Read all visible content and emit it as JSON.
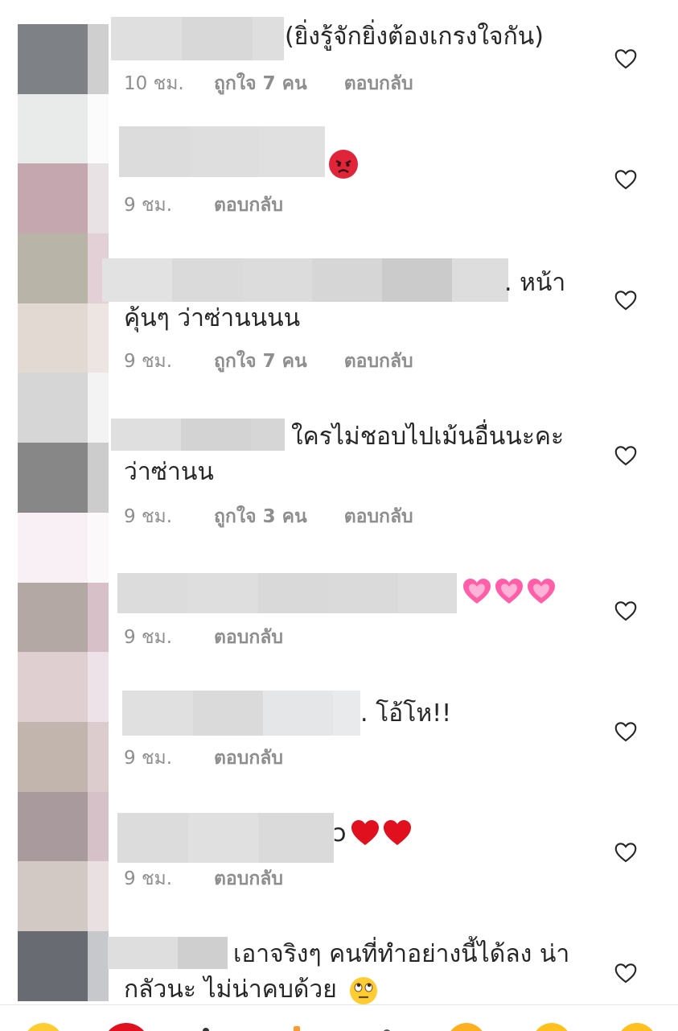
{
  "comments": [
    {
      "text": "(ยิ่งรู้จักยิ่งต้องเกรงใจกัน)",
      "time": "10 ชม.",
      "likes": "ถูกใจ 7 คน",
      "reply": "ตอบกลับ"
    },
    {
      "text": "",
      "time": "9 ชม.",
      "likes": "",
      "reply": "ตอบกลับ",
      "emoji": "pouting-face"
    },
    {
      "text": ". หน้า",
      "text2": "คุ้นๆ ว่าซ่านนนน",
      "time": "9 ชม.",
      "likes": "ถูกใจ 7 คน",
      "reply": "ตอบกลับ"
    },
    {
      "text": "ใครไม่ชอบไปเม้นอื่นนะคะ",
      "text2": "ว่าซ่านน",
      "time": "9 ชม.",
      "likes": "ถูกใจ 3 คน",
      "reply": "ตอบกลับ"
    },
    {
      "text": "",
      "time": "9 ชม.",
      "likes": "",
      "reply": "ตอบกลับ",
      "emoji": "growing-heart x3"
    },
    {
      "text": ". โอ้โห!!",
      "time": "9 ชม.",
      "likes": "",
      "reply": "ตอบกลับ"
    },
    {
      "text": "ɔ",
      "time": "9 ชม.",
      "likes": "",
      "reply": "ตอบกลับ",
      "emoji": "red-heart x2"
    },
    {
      "text": "เอาจริงๆ คนที่ทำอย่างนี้ได้ลง น่า",
      "text2": "กลัวนะ ไม่น่าคบด้วย",
      "time": "",
      "likes": "",
      "reply": "",
      "emoji": "face-with-rolling-eyes"
    }
  ],
  "icons": {
    "like": "heart-outline-icon"
  },
  "colors": {
    "meta": "#8e8e8e",
    "text": "#262626",
    "heart_stroke": "#262626",
    "blur": "#dcdcdc"
  }
}
